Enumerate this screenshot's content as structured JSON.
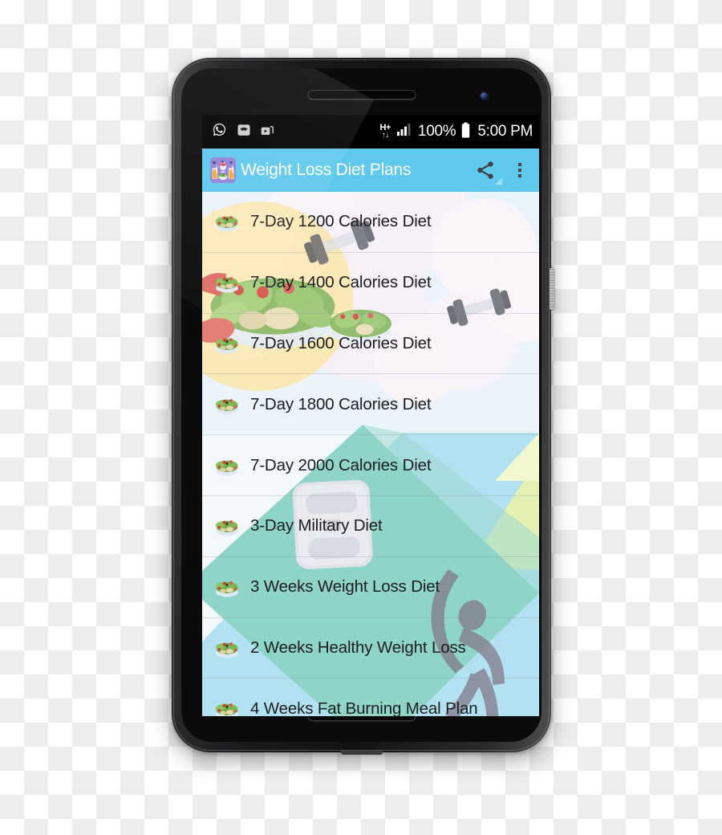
{
  "status_bar": {
    "left_icons": [
      "whatsapp-icon",
      "wifi-icon",
      "media-shortcut-icon"
    ],
    "network_type_top": "H+",
    "network_type_bottom": "↑↓",
    "signal_icon": "signal-bars-icon",
    "battery_percent": "100%",
    "battery_icon": "battery-full-icon",
    "clock": "5:00 PM"
  },
  "app_bar": {
    "app_icon": "diet-app-icon",
    "title": "Weight Loss Diet Plans",
    "share_icon": "share-icon",
    "overflow_icon": "overflow-menu-icon"
  },
  "list": {
    "items": [
      {
        "label": "7-Day 1200 Calories Diet",
        "icon": "salad-bowl-icon"
      },
      {
        "label": "7-Day 1400 Calories Diet",
        "icon": "salad-bowl-icon"
      },
      {
        "label": "7-Day 1600 Calories Diet",
        "icon": "salad-bowl-icon"
      },
      {
        "label": "7-Day 1800 Calories Diet",
        "icon": "salad-bowl-icon"
      },
      {
        "label": "7-Day 2000 Calories Diet",
        "icon": "salad-bowl-icon"
      },
      {
        "label": "3-Day Military Diet",
        "icon": "salad-bowl-icon"
      },
      {
        "label": "3 Weeks Weight Loss Diet",
        "icon": "salad-bowl-icon"
      },
      {
        "label": "2 Weeks Healthy Weight Loss",
        "icon": "salad-bowl-icon"
      },
      {
        "label": "4 Weeks Fat Burning Meal Plan",
        "icon": "salad-bowl-icon"
      }
    ]
  },
  "colors": {
    "app_bar": "#5FC9ED",
    "status_bar": "#000000",
    "wallpaper_yellow": "#FAE5A8",
    "wallpaper_teal": "#7FCFC2",
    "wallpaper_sky": "#A8DEF0",
    "wallpaper_lime": "#E2EFA8",
    "wallpaper_pale": "#E8F3FA",
    "row_text": "#1D1D1D"
  }
}
